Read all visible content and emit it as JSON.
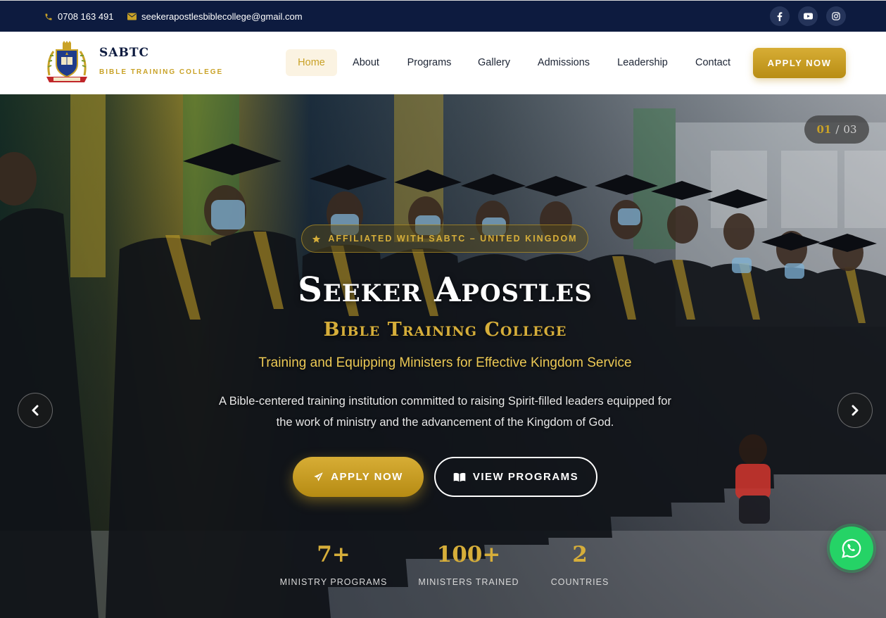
{
  "topbar": {
    "phone": "0708 163 491",
    "email": "seekerapostlesbiblecollege@gmail.com",
    "social": [
      "facebook-icon",
      "youtube-icon",
      "instagram-icon"
    ]
  },
  "brand": {
    "name": "SABTC",
    "subtitle": "BIBLE TRAINING COLLEGE"
  },
  "nav": {
    "items": [
      {
        "label": "Home",
        "active": true
      },
      {
        "label": "About"
      },
      {
        "label": "Programs"
      },
      {
        "label": "Gallery"
      },
      {
        "label": "Admissions"
      },
      {
        "label": "Leadership"
      },
      {
        "label": "Contact"
      }
    ],
    "apply_label": "APPLY NOW"
  },
  "hero": {
    "slide_current": "01",
    "slide_separator": "/",
    "slide_total": "03",
    "badge": "AFFILIATED WITH SABTC – UNITED KINGDOM",
    "title": "Seeker Apostles",
    "subtitle": "Bible Training College",
    "tagline": "Training and Equipping Ministers for Effective Kingdom Service",
    "description": "A Bible-centered training institution committed to raising Spirit-filled leaders equipped for the work of ministry and the advancement of the Kingdom of God.",
    "apply_label": "APPLY NOW",
    "programs_label": "VIEW PROGRAMS",
    "stats": [
      {
        "number": "7+",
        "label": "MINISTRY PROGRAMS"
      },
      {
        "number": "100+",
        "label": "MINISTERS TRAINED"
      },
      {
        "number": "2",
        "label": "COUNTRIES"
      }
    ]
  },
  "colors": {
    "navy": "#0d1b3f",
    "gold": "#c9a227",
    "whatsapp": "#25d366"
  }
}
